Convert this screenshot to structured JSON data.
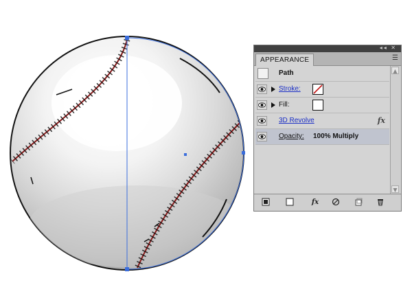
{
  "panel": {
    "tab_label": "APPEARANCE",
    "top_buttons": "◂◂ ✕",
    "menu_icon": "☰",
    "rows": [
      {
        "label": "Path",
        "kind": "header"
      },
      {
        "label": "Stroke:",
        "kind": "stroke",
        "swatch": "none-red-slash"
      },
      {
        "label": "Fill:",
        "kind": "fill",
        "swatch": "white"
      },
      {
        "label": "3D Revolve",
        "kind": "effect",
        "fx": "fx"
      },
      {
        "label": "Opacity:",
        "value": "100% Multiply",
        "kind": "opacity",
        "selected": true
      }
    ],
    "bottom_buttons": [
      "new-art-basic-icon",
      "clear-appearance-icon",
      "fx-menu-icon",
      "no-icon",
      "duplicate-item-icon",
      "trash-icon"
    ],
    "fx_glyph": "fx"
  },
  "colors": {
    "panel_bg": "#d4d4d4",
    "selection": "#c0c4cf",
    "link": "#1a2ec6",
    "guide_blue": "#3a6ddc",
    "stitch_red": "#b02020"
  }
}
